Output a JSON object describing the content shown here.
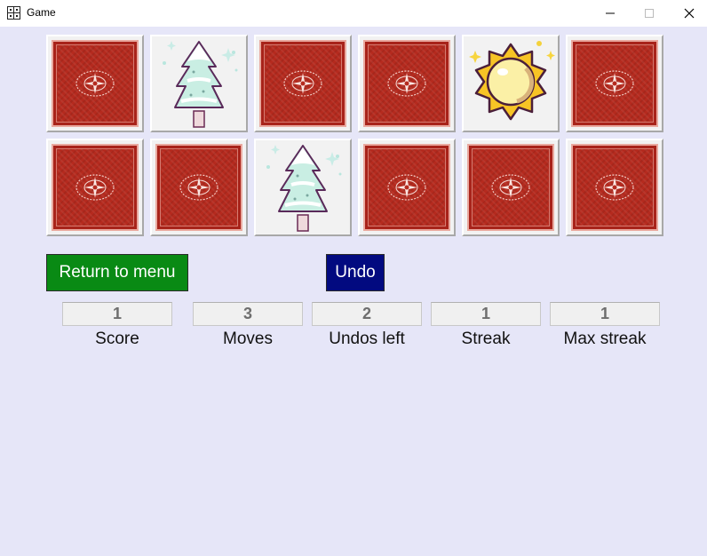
{
  "window": {
    "title": "Game",
    "icon": "app-grid-icon",
    "controls": [
      "minimize-icon",
      "maximize-icon",
      "close-icon"
    ]
  },
  "board": {
    "rows": 2,
    "columns": 6,
    "cards": [
      {
        "state": "face-down"
      },
      {
        "state": "face-up",
        "symbol": "pine-tree"
      },
      {
        "state": "face-down"
      },
      {
        "state": "face-down"
      },
      {
        "state": "face-up",
        "symbol": "sun"
      },
      {
        "state": "face-down"
      },
      {
        "state": "face-down"
      },
      {
        "state": "face-down"
      },
      {
        "state": "face-up",
        "symbol": "pine-tree"
      },
      {
        "state": "face-down"
      },
      {
        "state": "face-down"
      },
      {
        "state": "face-down"
      }
    ]
  },
  "buttons": {
    "return_to_menu": "Return to menu",
    "undo": "Undo"
  },
  "stats": {
    "score": {
      "value": "1",
      "label": "Score"
    },
    "moves": {
      "value": "3",
      "label": "Moves"
    },
    "undos_left": {
      "value": "2",
      "label": "Undos left"
    },
    "streak": {
      "value": "1",
      "label": "Streak"
    },
    "max_streak": {
      "value": "1",
      "label": "Max streak"
    }
  },
  "colors": {
    "background": "#e6e6f8",
    "menu_button": "#098a14",
    "undo_button": "#020a80",
    "card_back": "#b52a1e"
  }
}
